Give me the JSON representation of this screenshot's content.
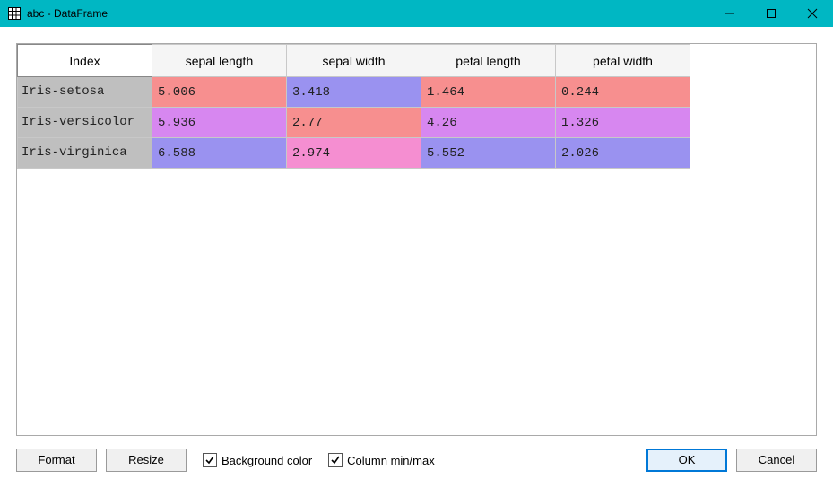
{
  "window": {
    "title": "abc - DataFrame"
  },
  "table": {
    "index_header": "Index",
    "columns": [
      "sepal length",
      "sepal width",
      "petal length",
      "petal width"
    ],
    "col_widths": {
      "index": 150,
      "data": 150
    },
    "rows": [
      {
        "index": "Iris-setosa",
        "cells": [
          {
            "value": "5.006",
            "bg": "#f78f8f"
          },
          {
            "value": "3.418",
            "bg": "#9a92f0"
          },
          {
            "value": "1.464",
            "bg": "#f78f8f"
          },
          {
            "value": "0.244",
            "bg": "#f78f8f"
          }
        ]
      },
      {
        "index": "Iris-versicolor",
        "cells": [
          {
            "value": "5.936",
            "bg": "#d787f0"
          },
          {
            "value": "2.77",
            "bg": "#f78f8f"
          },
          {
            "value": "4.26",
            "bg": "#d787f0"
          },
          {
            "value": "1.326",
            "bg": "#d787f0"
          }
        ]
      },
      {
        "index": "Iris-virginica",
        "cells": [
          {
            "value": "6.588",
            "bg": "#9a92f0"
          },
          {
            "value": "2.974",
            "bg": "#f58ed1"
          },
          {
            "value": "5.552",
            "bg": "#9a92f0"
          },
          {
            "value": "2.026",
            "bg": "#9a92f0"
          }
        ]
      }
    ]
  },
  "footer": {
    "format_label": "Format",
    "resize_label": "Resize",
    "bg_color_label": "Background color",
    "bg_color_checked": true,
    "minmax_label": "Column min/max",
    "minmax_checked": true,
    "ok_label": "OK",
    "cancel_label": "Cancel"
  },
  "chart_data": {
    "type": "table",
    "index": [
      "Iris-setosa",
      "Iris-versicolor",
      "Iris-virginica"
    ],
    "columns": [
      "sepal length",
      "sepal width",
      "petal length",
      "petal width"
    ],
    "data": [
      [
        5.006,
        3.418,
        1.464,
        0.244
      ],
      [
        5.936,
        2.77,
        4.26,
        1.326
      ],
      [
        6.588,
        2.974,
        5.552,
        2.026
      ]
    ]
  }
}
